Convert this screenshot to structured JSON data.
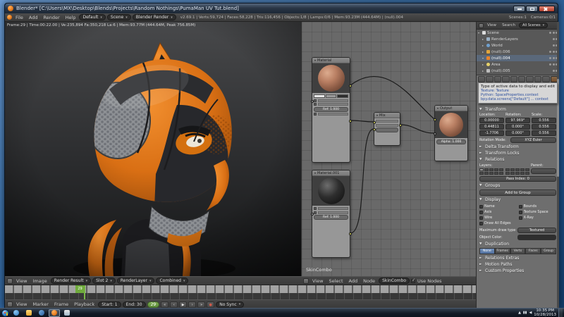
{
  "window": {
    "title": "Blender* [C:\\Users\\MX\\Desktop\\Blends\\Projects\\Random Nothings\\PumaMan UV Tut.blend]"
  },
  "topbar": {
    "menus": [
      "File",
      "Add",
      "Render",
      "Help"
    ],
    "layout": "Default",
    "scene": "Scene",
    "engine": "Blender Render",
    "stats": "v2.69.1 | Verts:59,724 | Faces:58,228 | Tris:116,456 | Objects:1/8 | Lamps:0/6 | Mem:93.23M (444.64M) | (null).004",
    "scenes_count": "Scenes:1",
    "cameras_count": "Cameras:0/1"
  },
  "image_editor": {
    "render_stats": "Frame:29 | Time:00:22.00 | Ve:235,894 Fa:350,218 La:6 | Mem:93.77M (444.64M, Peak 756.85M)",
    "menus": [
      "View",
      "Image"
    ],
    "datablock": "Render Result",
    "slot": "Slot 2",
    "layer": "RenderLayer",
    "pass": "Combined"
  },
  "node_editor": {
    "menus": [
      "View",
      "Select",
      "Add",
      "Node"
    ],
    "datablock": "SkinCombo",
    "use_nodes": "Use Nodes",
    "region_label": "SkinCombo",
    "nodes": [
      {
        "title": "Material",
        "slider": "Ref: 1.000"
      },
      {
        "title": "Material.001",
        "slider": "Ref: 1.000"
      },
      {
        "title": "Mix"
      },
      {
        "title": "Output",
        "slider": "Alpha: 1.000"
      }
    ]
  },
  "outliner": {
    "menu_view": "View",
    "menu_search": "Search",
    "filter": "All Scenes",
    "items": [
      "Scene",
      "RenderLayers",
      "World",
      "(null).006",
      "(null).004",
      "Area",
      "(null).005"
    ]
  },
  "tooltip": {
    "line1": "Type of active data to display and edit",
    "line2": "Texture: Texture",
    "line3": "Python: SpaceProperties.context",
    "line4": "bpy.data.screens[\"Default\"] ... context"
  },
  "properties": {
    "transform": {
      "title": "Transform",
      "location_label": "Location:",
      "rotation_label": "Rotation:",
      "scale_label": "Scale:",
      "location": [
        "0.00000",
        "0.44811",
        "-1.7706"
      ],
      "rotation": [
        "97.969°",
        "0.000°",
        "0.000°"
      ],
      "scale": [
        "0.556",
        "0.556",
        "0.556"
      ],
      "rotation_mode_label": "Rotation Mode:",
      "rotation_mode": "XYZ Euler"
    },
    "delta_transform": "Delta Transform",
    "transform_locks": "Transform Locks",
    "relations": {
      "title": "Relations",
      "layers_label": "Layers:",
      "parent_label": "Parent:",
      "pass_index": "Pass Index: 0"
    },
    "groups": {
      "title": "Groups",
      "add_button": "Add to Group"
    },
    "display": {
      "title": "Display",
      "checks_left": [
        "Name",
        "Axis",
        "Wire",
        "Draw All Edges"
      ],
      "checks_right": [
        "Bounds",
        "Texture Space",
        "X-Ray"
      ],
      "draw_type_label": "Maximum draw type:",
      "draw_type": "Textured",
      "object_color_label": "Object Color:"
    },
    "duplication": {
      "title": "Duplication",
      "options": [
        "None",
        "Frames",
        "Verts",
        "Faces",
        "Group"
      ]
    },
    "relations_extras": "Relations Extras",
    "motion_paths": "Motion Paths",
    "custom_properties": "Custom Properties"
  },
  "timeline": {
    "menus": [
      "View",
      "Marker",
      "Frame",
      "Playback"
    ],
    "start": "Start: 1",
    "end": "End: 30",
    "current": "29",
    "sync": "No Sync"
  },
  "taskbar": {
    "time": "10:35 PM",
    "date": "10/28/2013"
  }
}
